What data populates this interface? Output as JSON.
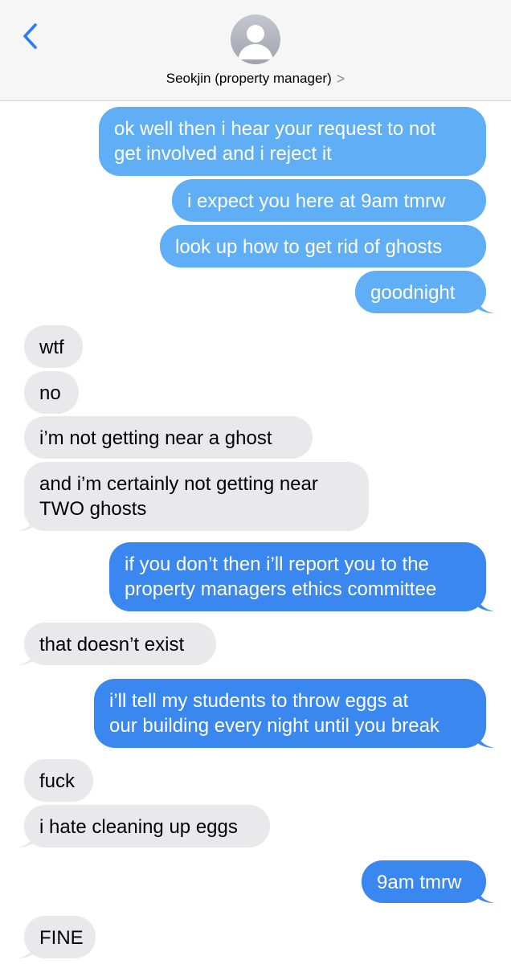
{
  "header": {
    "contact_name": "Seokjin (property manager)",
    "chevron": ">",
    "back_icon": "chevron-left-icon",
    "avatar_icon": "person-icon"
  },
  "colors": {
    "outgoing_light": "#60aef6",
    "outgoing_dark": "#3b87f0",
    "incoming": "#e9e9eb",
    "accent": "#2f7bf6"
  },
  "messages": [
    {
      "from": "me",
      "lines": [
        "ok well then i hear your request to not",
        "get involved and i reject it"
      ]
    },
    {
      "from": "me",
      "lines": [
        "i expect you here at 9am tmrw"
      ]
    },
    {
      "from": "me",
      "lines": [
        "look up how to get rid of ghosts"
      ]
    },
    {
      "from": "me",
      "lines": [
        "goodnight"
      ]
    },
    {
      "from": "them",
      "lines": [
        "wtf"
      ]
    },
    {
      "from": "them",
      "lines": [
        "no"
      ]
    },
    {
      "from": "them",
      "lines": [
        "i’m not getting near a ghost"
      ]
    },
    {
      "from": "them",
      "lines": [
        "and i’m certainly not getting near",
        "TWO ghosts"
      ]
    },
    {
      "from": "me",
      "lines": [
        "if you don’t then i’ll report you to the",
        "property managers ethics committee"
      ]
    },
    {
      "from": "them",
      "lines": [
        "that doesn’t exist"
      ]
    },
    {
      "from": "me",
      "lines": [
        "i’ll tell my students to throw eggs at",
        "our building every night until you break"
      ]
    },
    {
      "from": "them",
      "lines": [
        "fuck"
      ]
    },
    {
      "from": "them",
      "lines": [
        "i hate cleaning up eggs"
      ]
    },
    {
      "from": "me",
      "lines": [
        "9am tmrw"
      ]
    },
    {
      "from": "them",
      "lines": [
        "FINE"
      ]
    }
  ]
}
